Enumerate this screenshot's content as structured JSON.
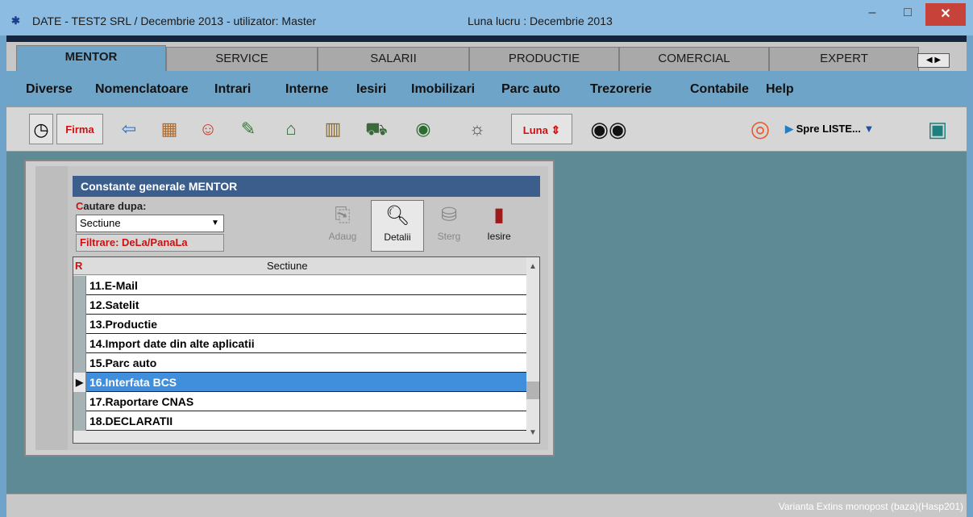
{
  "window": {
    "title": "DATE - TEST2 SRL / Decembrie 2013 - utilizator: Master",
    "luna_lucru": "Luna lucru : Decembrie 2013",
    "minimize": "–",
    "maximize": "□",
    "close": "✕"
  },
  "tabs": [
    {
      "label": "MENTOR"
    },
    {
      "label": "SERVICE"
    },
    {
      "label": "SALARII"
    },
    {
      "label": "PRODUCTIE"
    },
    {
      "label": "COMERCIAL"
    },
    {
      "label": "EXPERT"
    }
  ],
  "tab_nav": "◀ ▶",
  "menu": [
    {
      "label": "Diverse"
    },
    {
      "label": "Nomenclatoare"
    },
    {
      "label": "Intrari"
    },
    {
      "label": "Interne"
    },
    {
      "label": "Iesiri"
    },
    {
      "label": "Imobilizari"
    },
    {
      "label": "Parc auto"
    },
    {
      "label": "Trezorerie"
    },
    {
      "label": "Contabile"
    },
    {
      "label": "Help"
    }
  ],
  "toolbar": {
    "clock_icon": "clock-icon",
    "firma": "Firma",
    "luna": "Luna",
    "spre_liste": "Spre LISTE...",
    "icons": [
      "arrow-icon",
      "boxes-icon",
      "people-icon",
      "house-icon",
      "building-icon",
      "car-icon",
      "moneybag-icon",
      "bulb-icon",
      "eyes-icon",
      "lifebuoy-icon",
      "screens-icon"
    ]
  },
  "dialog": {
    "title": "Constante generale MENTOR",
    "search_label_prefix": "C",
    "search_label_rest": "autare dupa:",
    "search_value": "Sectiune",
    "filter_label": "Filtrare: DeLa/PanaLa",
    "buttons": {
      "adaug": "Adaug",
      "detalii": "Detalii",
      "sterg": "Sterg",
      "iesire": "Iesire"
    },
    "grid": {
      "r_header": "R",
      "column": "Sectiune",
      "rows": [
        {
          "label": "11.E-Mail"
        },
        {
          "label": "12.Satelit"
        },
        {
          "label": "13.Productie"
        },
        {
          "label": "14.Import date din alte aplicatii"
        },
        {
          "label": "15.Parc auto"
        },
        {
          "label": "16.Interfata BCS"
        },
        {
          "label": "17.Raportare CNAS"
        },
        {
          "label": "18.DECLARATII"
        }
      ],
      "selected_index": 5
    }
  },
  "status": "Varianta Extins monopost (baza)(Hasp201)",
  "colors": {
    "accent": "#3f8fdd",
    "menu_bg": "#6da4c7",
    "dialog_title": "#3b5e8c",
    "workspace": "#5d8a95",
    "red_text": "#cc1111"
  }
}
